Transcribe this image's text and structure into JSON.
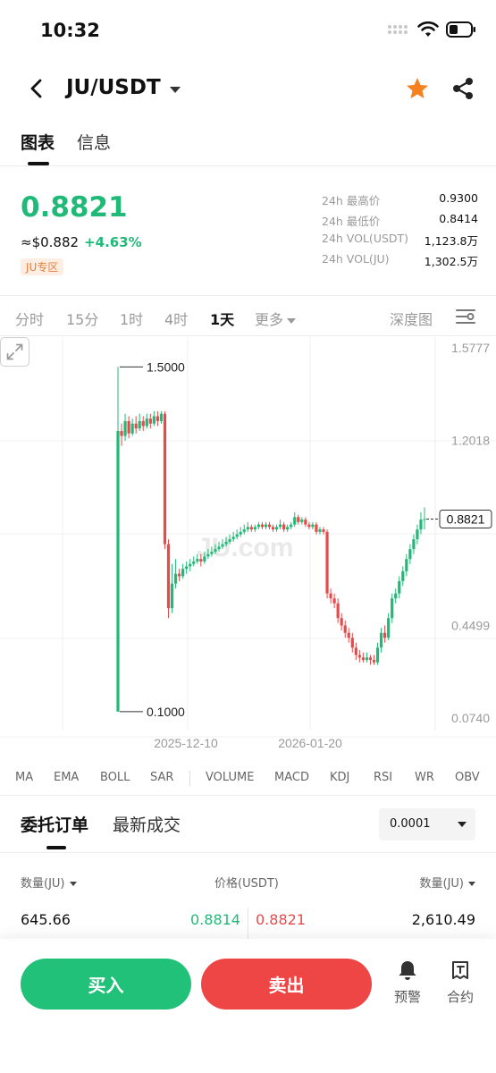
{
  "status_bar": {
    "time": "10:32"
  },
  "header": {
    "pair": "JU/USDT"
  },
  "main_tabs": [
    {
      "label": "图表"
    },
    {
      "label": "信息"
    }
  ],
  "ticker": {
    "last_price": "0.8821",
    "usd_approx": "≈$0.882",
    "change_pct": "+4.63%",
    "zone_badge": "JU专区",
    "stats": [
      {
        "label": "24h 最高价",
        "value": "0.9300"
      },
      {
        "label": "24h 最低价",
        "value": "0.8414"
      },
      {
        "label": "24h VOL(USDT)",
        "value": "1,123.8万"
      },
      {
        "label": "24h VOL(JU)",
        "value": "1,302.5万"
      }
    ]
  },
  "intervals": [
    {
      "label": "分时"
    },
    {
      "label": "15分"
    },
    {
      "label": "1时"
    },
    {
      "label": "4时"
    },
    {
      "label": "1天"
    },
    {
      "label": "更多"
    }
  ],
  "depth_label": "深度图",
  "chart_data": {
    "type": "candlestick",
    "y_axis_labels": [
      "1.5777",
      "1.2018",
      "0.4499",
      "0.0740"
    ],
    "y_range": [
      0.074,
      1.5777
    ],
    "x_axis_labels": [
      "2025-12-10",
      "2026-01-20"
    ],
    "high_marker": "1.5000",
    "low_marker": "0.1000",
    "current_price_label": "0.8821",
    "watermark": "JU.com",
    "up_color": "#21b978",
    "down_color": "#e84a4a",
    "candles": [
      [
        0.1,
        1.24,
        0.1,
        1.5
      ],
      [
        1.24,
        1.22,
        1.18,
        1.27
      ],
      [
        1.22,
        1.28,
        1.2,
        1.31
      ],
      [
        1.28,
        1.23,
        1.21,
        1.3
      ],
      [
        1.23,
        1.27,
        1.22,
        1.29
      ],
      [
        1.27,
        1.25,
        1.23,
        1.3
      ],
      [
        1.25,
        1.28,
        1.24,
        1.31
      ],
      [
        1.28,
        1.26,
        1.24,
        1.3
      ],
      [
        1.26,
        1.29,
        1.25,
        1.31
      ],
      [
        1.29,
        1.27,
        1.25,
        1.31
      ],
      [
        1.27,
        1.3,
        1.26,
        1.32
      ],
      [
        1.3,
        1.28,
        1.26,
        1.32
      ],
      [
        1.28,
        1.31,
        1.27,
        1.32
      ],
      [
        1.31,
        0.78,
        0.76,
        1.32
      ],
      [
        0.78,
        0.52,
        0.48,
        0.8
      ],
      [
        0.52,
        0.62,
        0.5,
        0.7
      ],
      [
        0.62,
        0.66,
        0.6,
        0.72
      ],
      [
        0.66,
        0.65,
        0.63,
        0.68
      ],
      [
        0.65,
        0.68,
        0.64,
        0.7
      ],
      [
        0.68,
        0.69,
        0.66,
        0.71
      ],
      [
        0.69,
        0.7,
        0.67,
        0.72
      ],
      [
        0.7,
        0.71,
        0.69,
        0.73
      ],
      [
        0.71,
        0.72,
        0.7,
        0.74
      ],
      [
        0.72,
        0.71,
        0.69,
        0.74
      ],
      [
        0.71,
        0.73,
        0.7,
        0.75
      ],
      [
        0.73,
        0.74,
        0.72,
        0.76
      ],
      [
        0.74,
        0.75,
        0.73,
        0.77
      ],
      [
        0.75,
        0.76,
        0.74,
        0.78
      ],
      [
        0.76,
        0.77,
        0.75,
        0.79
      ],
      [
        0.77,
        0.78,
        0.76,
        0.8
      ],
      [
        0.78,
        0.79,
        0.77,
        0.81
      ],
      [
        0.79,
        0.8,
        0.78,
        0.82
      ],
      [
        0.8,
        0.81,
        0.79,
        0.83
      ],
      [
        0.81,
        0.82,
        0.8,
        0.84
      ],
      [
        0.82,
        0.83,
        0.81,
        0.85
      ],
      [
        0.83,
        0.84,
        0.82,
        0.86
      ],
      [
        0.84,
        0.85,
        0.83,
        0.87
      ],
      [
        0.85,
        0.84,
        0.83,
        0.86
      ],
      [
        0.84,
        0.85,
        0.83,
        0.86
      ],
      [
        0.85,
        0.86,
        0.84,
        0.87
      ],
      [
        0.86,
        0.85,
        0.84,
        0.87
      ],
      [
        0.85,
        0.86,
        0.84,
        0.87
      ],
      [
        0.86,
        0.85,
        0.84,
        0.87
      ],
      [
        0.85,
        0.84,
        0.83,
        0.86
      ],
      [
        0.84,
        0.85,
        0.83,
        0.86
      ],
      [
        0.85,
        0.86,
        0.84,
        0.88
      ],
      [
        0.86,
        0.84,
        0.83,
        0.87
      ],
      [
        0.84,
        0.85,
        0.83,
        0.86
      ],
      [
        0.85,
        0.86,
        0.84,
        0.87
      ],
      [
        0.86,
        0.89,
        0.85,
        0.91
      ],
      [
        0.89,
        0.87,
        0.86,
        0.9
      ],
      [
        0.87,
        0.88,
        0.86,
        0.89
      ],
      [
        0.88,
        0.86,
        0.85,
        0.89
      ],
      [
        0.86,
        0.85,
        0.84,
        0.87
      ],
      [
        0.85,
        0.86,
        0.84,
        0.87
      ],
      [
        0.86,
        0.83,
        0.82,
        0.87
      ],
      [
        0.83,
        0.84,
        0.82,
        0.85
      ],
      [
        0.84,
        0.83,
        0.82,
        0.85
      ],
      [
        0.83,
        0.58,
        0.56,
        0.84
      ],
      [
        0.58,
        0.56,
        0.54,
        0.6
      ],
      [
        0.56,
        0.54,
        0.52,
        0.58
      ],
      [
        0.54,
        0.48,
        0.46,
        0.56
      ],
      [
        0.48,
        0.45,
        0.43,
        0.5
      ],
      [
        0.45,
        0.42,
        0.4,
        0.47
      ],
      [
        0.42,
        0.4,
        0.38,
        0.44
      ],
      [
        0.4,
        0.36,
        0.34,
        0.42
      ],
      [
        0.36,
        0.33,
        0.31,
        0.38
      ],
      [
        0.33,
        0.32,
        0.3,
        0.35
      ],
      [
        0.32,
        0.31,
        0.3,
        0.34
      ],
      [
        0.31,
        0.32,
        0.3,
        0.34
      ],
      [
        0.32,
        0.31,
        0.29,
        0.33
      ],
      [
        0.31,
        0.3,
        0.29,
        0.33
      ],
      [
        0.3,
        0.36,
        0.29,
        0.38
      ],
      [
        0.36,
        0.42,
        0.34,
        0.44
      ],
      [
        0.42,
        0.4,
        0.38,
        0.45
      ],
      [
        0.4,
        0.48,
        0.39,
        0.5
      ],
      [
        0.48,
        0.56,
        0.46,
        0.58
      ],
      [
        0.56,
        0.58,
        0.54,
        0.6
      ],
      [
        0.58,
        0.63,
        0.56,
        0.65
      ],
      [
        0.63,
        0.67,
        0.61,
        0.69
      ],
      [
        0.67,
        0.72,
        0.65,
        0.74
      ],
      [
        0.72,
        0.76,
        0.7,
        0.78
      ],
      [
        0.76,
        0.8,
        0.74,
        0.82
      ],
      [
        0.8,
        0.84,
        0.78,
        0.86
      ],
      [
        0.84,
        0.88,
        0.82,
        0.91
      ],
      [
        0.88,
        0.8821,
        0.84,
        0.93
      ]
    ]
  },
  "indicators": [
    "MA",
    "EMA",
    "BOLL",
    "SAR",
    "VOLUME",
    "MACD",
    "KDJ",
    "RSI",
    "WR",
    "OBV"
  ],
  "order_tabs": [
    {
      "label": "委托订单"
    },
    {
      "label": "最新成交"
    }
  ],
  "precision": "0.0001",
  "order_book": {
    "header": {
      "qty_left": "数量(JU)",
      "price": "价格(USDT)",
      "qty_right": "数量(JU)"
    },
    "rows": [
      {
        "bid_qty": "645.66",
        "bid_price": "0.8814",
        "ask_price": "0.8821",
        "ask_qty": "2,610.49"
      }
    ]
  },
  "bottom": {
    "buy": "买入",
    "sell": "卖出",
    "alert": "预警",
    "contract": "合约"
  }
}
